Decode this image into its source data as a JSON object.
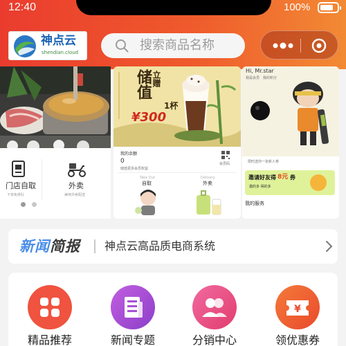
{
  "status_bar": {
    "time": "12:40",
    "battery_percent": "100%",
    "battery_level": 1.0
  },
  "header": {
    "logo": {
      "name": "神点云",
      "domain": "shendian.cloud"
    },
    "search": {
      "placeholder": "搜索商品名称",
      "icon": "search-icon"
    },
    "capsule": {
      "more_icon": "more-dots-icon",
      "close_icon": "target-close-icon"
    }
  },
  "banner": {
    "left": {
      "services": [
        {
          "label": "门店自取",
          "sub": "下单免排队",
          "icon": "store-pickup-icon"
        },
        {
          "label": "外卖",
          "sub": "美味外卖配送",
          "icon": "scooter-delivery-icon"
        }
      ],
      "dots": 2,
      "active_dot": 0
    },
    "middle": {
      "promo_main": "储值",
      "promo_side": "立赠",
      "promo_cup": "1杯",
      "promo_price": "¥300",
      "balance_label": "我的余额",
      "balance_value": "0",
      "member_tip": "储值更多会员权益",
      "member_code": "会员码",
      "pickup_en": "Take Out",
      "pickup_label": "自取",
      "delivery_en": "Delivery",
      "delivery_label": "外卖"
    },
    "right": {
      "greeting": "Hi, Mr.star",
      "lines": [
        "我是会员",
        "我的积分"
      ],
      "coupon_text": "限时送你一张新人券",
      "invite_main": "邀请好友得",
      "invite_amount": "8元",
      "invite_suffix": "券",
      "invite_sub": "邀的多 得的多",
      "my_services": "我的服务"
    }
  },
  "news": {
    "tag_a": "新闻",
    "tag_b": "简报",
    "text": "神点云高品质电商系统"
  },
  "grid": {
    "items": [
      {
        "label": "精品推荐",
        "icon": "grid-apps-icon",
        "color": "#f0533f"
      },
      {
        "label": "新闻专题",
        "icon": "newspaper-icon",
        "color": "#a94fd6"
      },
      {
        "label": "分销中心",
        "icon": "people-icon",
        "color": "#e8467c"
      },
      {
        "label": "领优惠券",
        "icon": "yen-ticket-icon",
        "color": "#f05a33"
      }
    ]
  },
  "colors": {
    "header_start": "#ea3c2e",
    "header_end": "#f28a34",
    "accent_blue": "#4a8ee8"
  }
}
